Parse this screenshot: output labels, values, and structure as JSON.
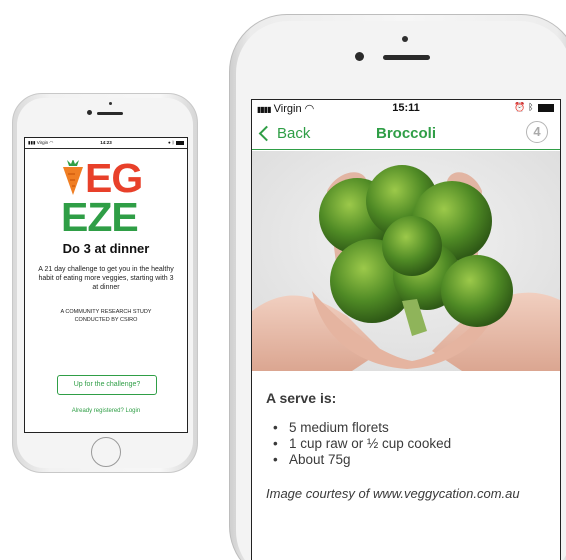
{
  "small_phone": {
    "status": {
      "carrier": "Virgin",
      "time": "14:23"
    },
    "logo": {
      "row1": "EG",
      "row2": "EZE"
    },
    "tagline": "Do 3 at dinner",
    "description": "A 21 day challenge to get you in the healthy habit of eating more veggies, starting with 3 at dinner",
    "study_line1": "A COMMUNITY RESEARCH STUDY",
    "study_line2": "CONDUCTED BY CSIRO",
    "challenge_button": "Up for the challenge?",
    "login_link": "Already registered? Login"
  },
  "large_phone": {
    "status": {
      "carrier": "Virgin",
      "time": "15:11"
    },
    "nav": {
      "back_label": "Back",
      "title": "Broccoli",
      "badge": "4"
    },
    "serve_heading": "A serve is:",
    "serve_items": [
      "5 medium florets",
      "1 cup raw or ½ cup cooked",
      "About 75g"
    ],
    "credit": "Image courtesy of www.veggycation.com.au"
  },
  "colors": {
    "brand_green": "#2f9e46",
    "logo_purple": "#7b2a8e",
    "logo_red": "#e8402a",
    "logo_orange": "#f07e23"
  },
  "icons": [
    "signal-icon",
    "wifi-icon",
    "alarm-icon",
    "bluetooth-icon",
    "battery-icon",
    "chevron-left-icon",
    "carrot-icon"
  ]
}
